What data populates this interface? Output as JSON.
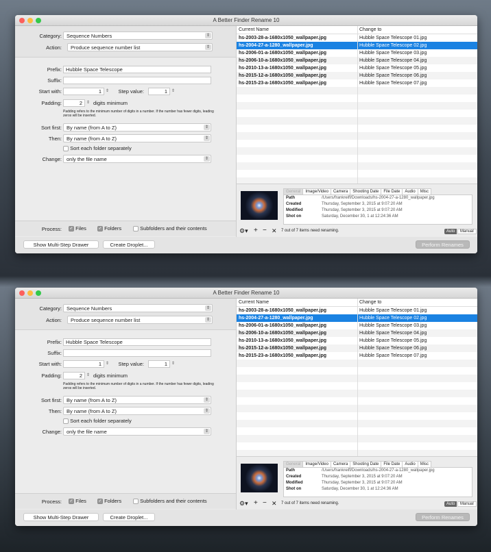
{
  "window": {
    "title": "A Better Finder Rename 10"
  },
  "colors": {
    "selection": "#1a82e2",
    "close": "#fc605c",
    "minimize": "#fdbc40",
    "zoom": "#34c84a"
  },
  "settings": {
    "category_label": "Category:",
    "category_value": "Sequence Numbers",
    "action_label": "Action:",
    "action_value": "Produce sequence number list",
    "prefix_label": "Prefix:",
    "prefix_value": "Hubble Space Telescope",
    "suffix_label": "Suffix:",
    "suffix_value": "",
    "start_label": "Start with:",
    "start_value": "1",
    "step_label": "Step value:",
    "step_value": "1",
    "padding_label": "Padding:",
    "padding_value": "2",
    "padding_unit": "digits minimum",
    "padding_note": "Padding refers to the minimum number of digits in a number. If the number has fewer digits, leading zeros will be inserted.",
    "sort_first_label": "Sort first:",
    "sort_first_value": "By name (from A to Z)",
    "then_label": "Then:",
    "then_value": "By name (from A to Z)",
    "sort_folder_label": "Sort each folder separately",
    "change_label": "Change:",
    "change_value": "only the file name"
  },
  "process": {
    "label": "Process:",
    "files": "Files",
    "folders": "Folders",
    "subfolders": "Subfolders and their contents"
  },
  "buttons": {
    "drawer": "Show Multi-Step Drawer",
    "droplet": "Create Droplet...",
    "perform": "Perform Renames",
    "auto": "Auto",
    "manual": "Manual"
  },
  "table": {
    "headers": [
      "Current Name",
      "Change to"
    ],
    "rows": [
      {
        "current": "hs-2003-28-a-1680x1050_wallpaper.jpg",
        "new": "Hubble Space Telescope 01.jpg"
      },
      {
        "current": "hs-2004-27-a-1280_wallpaper.jpg",
        "new": "Hubble Space Telescope 02.jpg"
      },
      {
        "current": "hs-2006-01-a-1680x1050_wallpaper.jpg",
        "new": "Hubble Space Telescope 03.jpg"
      },
      {
        "current": "hs-2006-10-a-1680x1050_wallpaper.jpg",
        "new": "Hubble Space Telescope 04.jpg"
      },
      {
        "current": "hs-2010-13-a-1680x1050_wallpaper.jpg",
        "new": "Hubble Space Telescope 05.jpg"
      },
      {
        "current": "hs-2015-12-a-1680x1050_wallpaper.jpg",
        "new": "Hubble Space Telescope 06.jpg"
      },
      {
        "current": "hs-2015-23-a-1680x1050_wallpaper.jpg",
        "new": "Hubble Space Telescope 07.jpg"
      }
    ]
  },
  "info": {
    "tabs": [
      "General",
      "Image/Video",
      "Camera",
      "Shooting Date",
      "File Date",
      "Audio",
      "Misc"
    ],
    "rows": [
      {
        "key": "Path",
        "value": "/Users/frankreiff/Downloads/hs-2004-27-a-1280_wallpaper.jpg"
      },
      {
        "key": "Created",
        "value": "Thursday, September 3, 2015 at 9:07:20 AM"
      },
      {
        "key": "Modified",
        "value": "Thursday, September 3, 2015 at 9:07:20 AM"
      },
      {
        "key": "Shot on",
        "value": "Saturday, December 30, 1 at 12:24:36 AM"
      }
    ]
  },
  "status": {
    "text": "7 out of 7 items need renaming."
  }
}
